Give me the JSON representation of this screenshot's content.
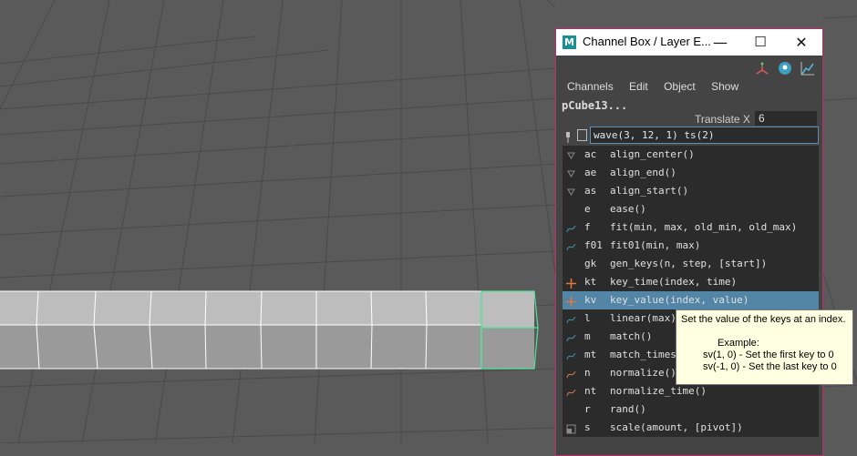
{
  "window": {
    "title": "Channel Box / Layer E...",
    "logo_letter": "M",
    "minimize_glyph": "—",
    "maximize_glyph": "☐",
    "close_glyph": "✕"
  },
  "toolbar_icons": [
    "axes-icon",
    "globe-icon",
    "graph-icon"
  ],
  "menu": [
    "Channels",
    "Edit",
    "Object",
    "Show"
  ],
  "object_name": "pCube13...",
  "attribute": {
    "label": "Translate X",
    "value": "6"
  },
  "expression_input": {
    "value": "wave(3, 12, 1) ts(2)"
  },
  "completions": [
    {
      "icon": "align-center-icon",
      "abbr": "ac",
      "signature": "align_center()"
    },
    {
      "icon": "align-end-icon",
      "abbr": "ae",
      "signature": "align_end()"
    },
    {
      "icon": "align-start-icon",
      "abbr": "as",
      "signature": "align_start()"
    },
    {
      "icon": "",
      "abbr": "e",
      "signature": "ease()"
    },
    {
      "icon": "fit-icon",
      "abbr": "f",
      "signature": "fit(min, max, old_min, old_max)"
    },
    {
      "icon": "fit01-icon",
      "abbr": "f01",
      "signature": "fit01(min, max)"
    },
    {
      "icon": "",
      "abbr": "gk",
      "signature": "gen_keys(n, step, [start])"
    },
    {
      "icon": "key-time-icon",
      "abbr": "kt",
      "signature": "key_time(index, time)"
    },
    {
      "icon": "key-value-icon",
      "abbr": "kv",
      "signature": "key_value(index, value)",
      "selected": true
    },
    {
      "icon": "linear-icon",
      "abbr": "l",
      "signature": "linear(max)"
    },
    {
      "icon": "match-icon",
      "abbr": "m",
      "signature": "match()"
    },
    {
      "icon": "match-times-icon",
      "abbr": "mt",
      "signature": "match_times"
    },
    {
      "icon": "normalize-icon",
      "abbr": "n",
      "signature": "normalize()"
    },
    {
      "icon": "normalize-time-icon",
      "abbr": "nt",
      "signature": "normalize_time()"
    },
    {
      "icon": "",
      "abbr": "r",
      "signature": "rand()"
    },
    {
      "icon": "scale-icon",
      "abbr": "s",
      "signature": "scale(amount, [pivot])"
    }
  ],
  "tooltip": {
    "line1": "Set the value of the keys at an index.",
    "line2": "Example:",
    "line3": "sv(1, 0) - Set the first key to 0",
    "line4": "sv(-1, 0) - Set the last key to 0"
  },
  "colors": {
    "selection": "#5285a6",
    "window_border": "#c02b6e",
    "tooltip_bg": "#ffffe1",
    "selected_mesh_edge": "#4ee6a0"
  }
}
